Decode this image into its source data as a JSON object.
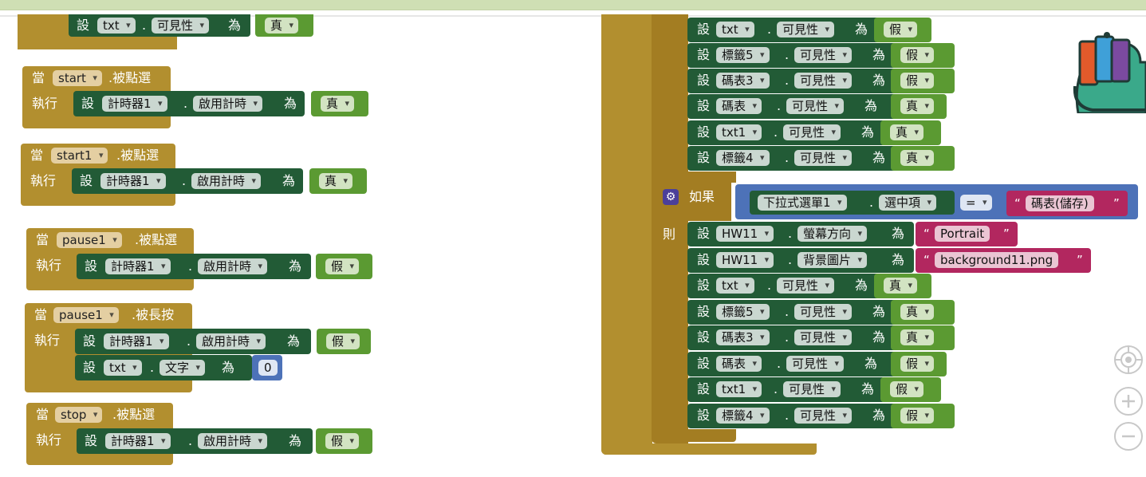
{
  "colors": {
    "event": "#b28f2f",
    "setter": "#225b36",
    "logic": "#5b9a32",
    "number": "#4d72b8",
    "text": "#b2275f",
    "control": "#a37d22",
    "topbar": "#cfdfb4"
  },
  "kw": {
    "when": "當",
    "do": "執行",
    "set": "設",
    "to": "為",
    "if": "如果",
    "then": "則",
    "dot": ".",
    "open_q": "“",
    "close_q": "”"
  },
  "comp": {
    "timer": "計時器1",
    "txt": "txt",
    "txt1": "txt1",
    "label5": "標籤5",
    "label4": "標籤4",
    "stopwatch3": "碼表3",
    "stopwatch": "碼表",
    "hw11": "HW11",
    "dropdown": "下拉式選單1"
  },
  "prop": {
    "visible": "可見性",
    "timer_enabled": "啟用計時",
    "text": "文字",
    "orientation": "螢幕方向",
    "bg_image": "背景圖片",
    "selection": "選中項"
  },
  "val": {
    "true": "真",
    "false": "假",
    "zero": "0",
    "portrait": "Portrait",
    "bg_file": "background11.png",
    "stopwatch_saved": "碼表(儲存)",
    "eq": "="
  },
  "events": {
    "start": {
      "comp": "start",
      "ev": ".被點選"
    },
    "start1": {
      "comp": "start1",
      "ev": ".被點選"
    },
    "pause1_click": {
      "comp": "pause1",
      "ev": ".被點選"
    },
    "pause1_long": {
      "comp": "pause1",
      "ev": ".被長按"
    },
    "stop": {
      "comp": "stop",
      "ev": ".被點選"
    }
  },
  "icons": {
    "workspace_bag": "backpack-icon",
    "center": "crosshair-icon",
    "zoom_in": "plus-icon",
    "zoom_out": "minus-icon",
    "gear": "gear-icon"
  }
}
